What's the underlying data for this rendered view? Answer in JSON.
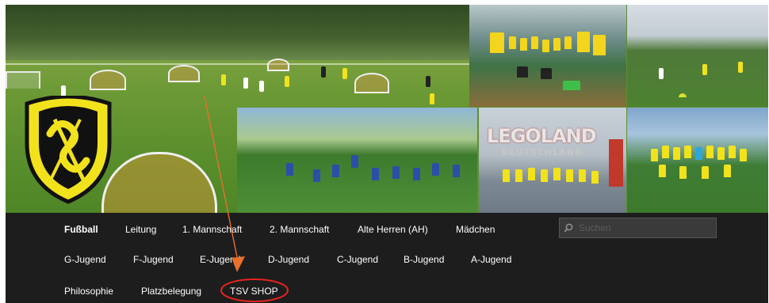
{
  "nav": {
    "row1": [
      "Fußball",
      "Leitung",
      "1. Mannschaft",
      "2. Mannschaft",
      "Alte Herren (AH)",
      "Mädchen"
    ],
    "row2": [
      "G-Jugend",
      "F-Jugend",
      "E-Jugend",
      "D-Jugend",
      "C-Jugend",
      "B-Jugend",
      "A-Jugend"
    ],
    "row3": [
      "Philosophie",
      "Platzbelegung",
      "TSV SHOP"
    ],
    "active": "Fußball"
  },
  "search": {
    "placeholder": "Suchen"
  },
  "banner": {
    "lego_title": "LEGOLAND",
    "lego_subtitle": "DEUTSCHLAND"
  },
  "colors": {
    "nav_background": "#1d1d1d",
    "nav_text": "#ffffff",
    "annotation": "#e8702a",
    "highlight_circle": "#e8231f",
    "club_yellow": "#f2e21c"
  },
  "icons": {
    "search": "search-icon",
    "logo": "club-crest-icon"
  }
}
